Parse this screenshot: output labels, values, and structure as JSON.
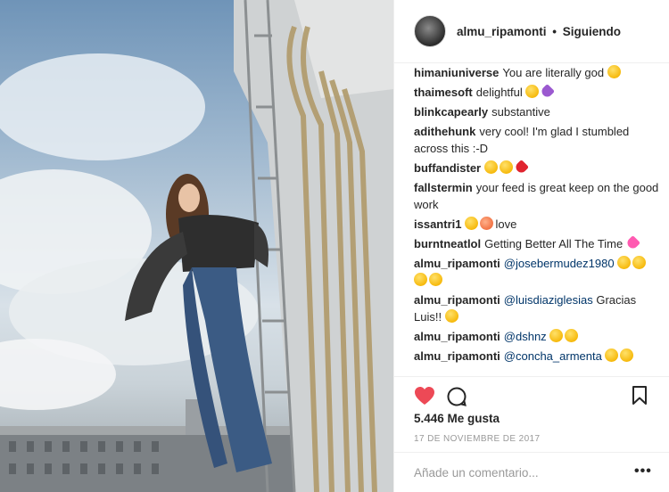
{
  "header": {
    "username": "almu_ripamonti",
    "separator": "•",
    "follow_status": "Siguiendo"
  },
  "comments": [
    {
      "user": "himaniuniverse",
      "text": "You are literally god",
      "emoji": [
        "yellow"
      ]
    },
    {
      "user": "thaimesoft",
      "text": "delightful",
      "emoji": [
        "yellow",
        "purple"
      ]
    },
    {
      "user": "blinkcapearly",
      "text": "substantive",
      "emoji": []
    },
    {
      "user": "adithehunk",
      "text": "very cool! I'm glad I stumbled across this :-D",
      "emoji": []
    },
    {
      "user": "buffandister",
      "text": "",
      "emoji": [
        "yellow",
        "yellow",
        "heart"
      ]
    },
    {
      "user": "fallstermin",
      "text": "your feed is great keep on the good work",
      "emoji": []
    },
    {
      "user": "issantri1",
      "text": "love",
      "emoji_before": [
        "yellow",
        "peach"
      ],
      "emoji": []
    },
    {
      "user": "burntneatlol",
      "text": "Getting Better All The Time",
      "emoji": [
        "pink"
      ]
    },
    {
      "user": "almu_ripamonti",
      "mention": "@josebermudez1980",
      "text": "",
      "emoji": [
        "yellow",
        "yellow",
        "yellow",
        "yellow"
      ]
    },
    {
      "user": "almu_ripamonti",
      "mention": "@luisdiaziglesias",
      "text": "Gracias Luis!!",
      "emoji": [
        "yellow"
      ]
    },
    {
      "user": "almu_ripamonti",
      "mention": "@dshnz",
      "text": "",
      "emoji": [
        "yellow",
        "yellow"
      ]
    },
    {
      "user": "almu_ripamonti",
      "mention": "@concha_armenta",
      "text": "",
      "emoji": [
        "yellow",
        "yellow"
      ]
    }
  ],
  "actions": {
    "like_icon": "heart-icon",
    "comment_icon": "comment-icon",
    "save_icon": "bookmark-icon",
    "like_color": "#ed4956"
  },
  "likes": "5.446 Me gusta",
  "date": "17 DE NOVIEMBRE DE 2017",
  "add_comment": {
    "placeholder": "Añade un comentario...",
    "more": "•••"
  }
}
